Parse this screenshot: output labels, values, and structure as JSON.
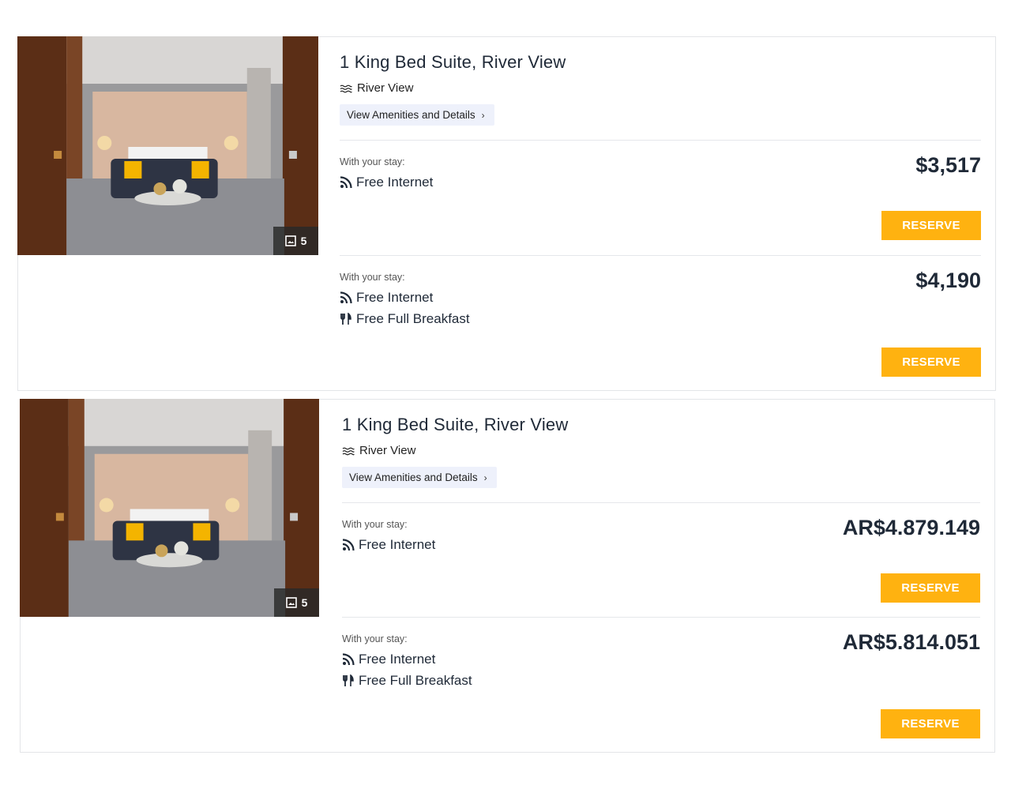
{
  "rooms": [
    {
      "title": "1 King Bed Suite, River View",
      "view_label": "River View",
      "details_label": "View Amenities and Details",
      "details_chevron": "›",
      "photo_count": "5",
      "rates": [
        {
          "stay_label": "With your stay:",
          "perks": [
            {
              "icon": "wifi-icon",
              "label": "Free Internet"
            }
          ],
          "price": "$3,517",
          "reserve_label": "RESERVE"
        },
        {
          "stay_label": "With your stay:",
          "perks": [
            {
              "icon": "wifi-icon",
              "label": "Free Internet"
            },
            {
              "icon": "utensils-icon",
              "label": "Free Full Breakfast"
            }
          ],
          "price": "$4,190",
          "reserve_label": "RESERVE"
        }
      ]
    },
    {
      "title": "1 King Bed Suite, River View",
      "view_label": "River View",
      "details_label": "View Amenities and Details",
      "details_chevron": "›",
      "photo_count": "5",
      "rates": [
        {
          "stay_label": "With your stay:",
          "perks": [
            {
              "icon": "wifi-icon",
              "label": "Free Internet"
            }
          ],
          "price": "AR$4.879.149",
          "reserve_label": "RESERVE"
        },
        {
          "stay_label": "With your stay:",
          "perks": [
            {
              "icon": "wifi-icon",
              "label": "Free Internet"
            },
            {
              "icon": "utensils-icon",
              "label": "Free Full Breakfast"
            }
          ],
          "price": "AR$5.814.051",
          "reserve_label": "RESERVE"
        }
      ]
    }
  ],
  "colors": {
    "accent": "#ffb210",
    "details_bg": "#eef1fb",
    "text": "#1f2937",
    "border": "#e3e5e8"
  }
}
